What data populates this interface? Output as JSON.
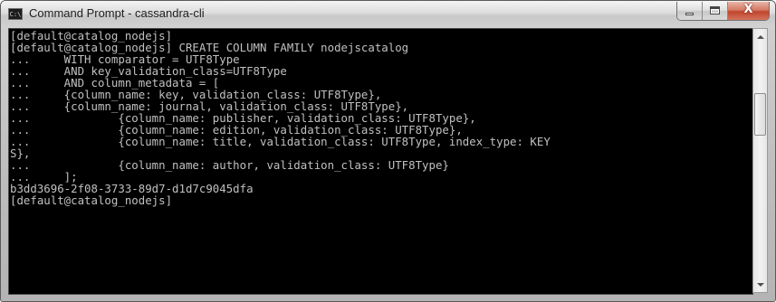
{
  "window": {
    "title": "Command Prompt - cassandra-cli",
    "icon": "cmd-icon",
    "icon_text": "C:\\",
    "buttons": {
      "minimize": "minimize-icon",
      "maximize": "maximize-icon",
      "close": "close-icon",
      "close_glyph": "X"
    }
  },
  "console": {
    "lines": [
      "[default@catalog_nodejs]",
      "[default@catalog_nodejs] CREATE COLUMN FAMILY nodejscatalog",
      "...     WITH comparator = UTF8Type",
      "...     AND key_validation_class=UTF8Type",
      "...     AND column_metadata = [",
      "...     {column_name: key, validation_class: UTF8Type},",
      "...     {column_name: journal, validation_class: UTF8Type},",
      "...             {column_name: publisher, validation_class: UTF8Type},",
      "...             {column_name: edition, validation_class: UTF8Type},",
      "...             {column_name: title, validation_class: UTF8Type, index_type: KEY",
      "S},",
      "...             {column_name: author, validation_class: UTF8Type}",
      "...     ];",
      "b3dd3696-2f08-3733-89d7-d1d7c9045dfa",
      "[default@catalog_nodejs]"
    ],
    "colors": {
      "background": "#000000",
      "text": "#c0c0c0"
    }
  }
}
